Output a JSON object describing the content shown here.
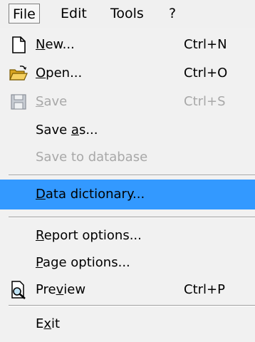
{
  "menubar": {
    "file": "File",
    "edit": "Edit",
    "tools": "Tools",
    "help": "?"
  },
  "menu": {
    "new": {
      "label_pre": "",
      "label_key": "N",
      "label_post": "ew...",
      "accel": "Ctrl+N",
      "icon": "document-icon"
    },
    "open": {
      "label_pre": "",
      "label_key": "O",
      "label_post": "pen...",
      "accel": "Ctrl+O",
      "icon": "open-folder-icon"
    },
    "save": {
      "label_pre": "",
      "label_key": "S",
      "label_post": "ave",
      "accel": "Ctrl+S",
      "icon": "floppy-disk-icon",
      "disabled": true
    },
    "save_as": {
      "label_pre": "Save ",
      "label_key": "a",
      "label_post": "s..."
    },
    "save_db": {
      "label": "Save to database",
      "disabled": true
    },
    "data_dict": {
      "label_pre": "",
      "label_key": "D",
      "label_post": "ata dictionary...",
      "highlighted": true
    },
    "report_opt": {
      "label_pre": "",
      "label_key": "R",
      "label_post": "eport options..."
    },
    "page_opt": {
      "label_pre": "",
      "label_key": "P",
      "label_post": "age options..."
    },
    "preview": {
      "label_pre": "Pre",
      "label_key": "v",
      "label_post": "iew",
      "accel": "Ctrl+P",
      "icon": "print-preview-icon"
    },
    "exit": {
      "label_pre": "E",
      "label_key": "x",
      "label_post": "it"
    }
  }
}
